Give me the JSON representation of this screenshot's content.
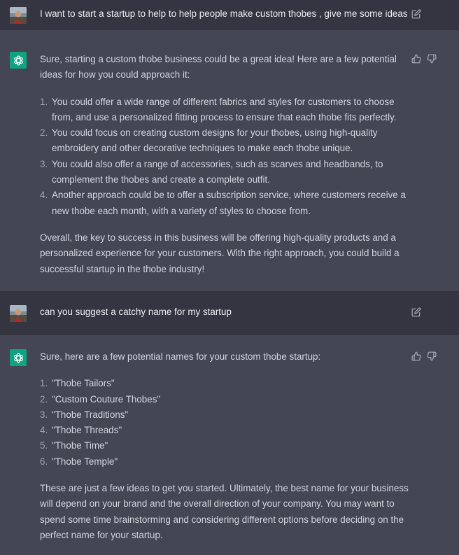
{
  "conversation": [
    {
      "role": "user",
      "text": "I want to start a startup to help to help people make custom thobes , give me some ideas"
    },
    {
      "role": "assistant",
      "intro": "Sure, starting a custom thobe business could be a great idea! Here are a few potential ideas for how you could approach it:",
      "items": [
        {
          "num": "1.",
          "text": "You could offer a wide range of different fabrics and styles for customers to choose from, and use a personalized fitting process to ensure that each thobe fits perfectly."
        },
        {
          "num": "2.",
          "text": "You could focus on creating custom designs for your thobes, using high-quality embroidery and other decorative techniques to make each thobe unique."
        },
        {
          "num": "3.",
          "text": "You could also offer a range of accessories, such as scarves and headbands, to complement the thobes and create a complete outfit."
        },
        {
          "num": "4.",
          "text": "Another approach could be to offer a subscription service, where customers receive a new thobe each month, with a variety of styles to choose from."
        }
      ],
      "outro": "Overall, the key to success in this business will be offering high-quality products and a personalized experience for your customers. With the right approach, you could build a successful startup in the thobe industry!"
    },
    {
      "role": "user",
      "text": "can you suggest a catchy name for my startup"
    },
    {
      "role": "assistant",
      "intro": "Sure, here are a few potential names for your custom thobe startup:",
      "items": [
        {
          "num": "1.",
          "text": "\"Thobe Tailors\""
        },
        {
          "num": "2.",
          "text": "\"Custom Couture Thobes\""
        },
        {
          "num": "3.",
          "text": "\"Thobe Traditions\""
        },
        {
          "num": "4.",
          "text": "\"Thobe Threads\""
        },
        {
          "num": "5.",
          "text": "\"Thobe Time\""
        },
        {
          "num": "6.",
          "text": "\"Thobe Temple\""
        }
      ],
      "outro": "These are just a few ideas to get you started. Ultimately, the best name for your business will depend on your brand and the overall direction of your company. You may want to spend some time brainstorming and considering different options before deciding on the perfect name for your startup."
    }
  ],
  "icons": {
    "edit": "edit-icon",
    "thumbs_up": "thumbs-up-icon",
    "thumbs_down": "thumbs-down-icon",
    "assistant_logo": "openai-logo-icon",
    "user_avatar": "user-avatar"
  },
  "colors": {
    "user_bg": "#343541",
    "assistant_bg": "#444654",
    "text": "#d1d5db",
    "brand": "#10a37f"
  }
}
